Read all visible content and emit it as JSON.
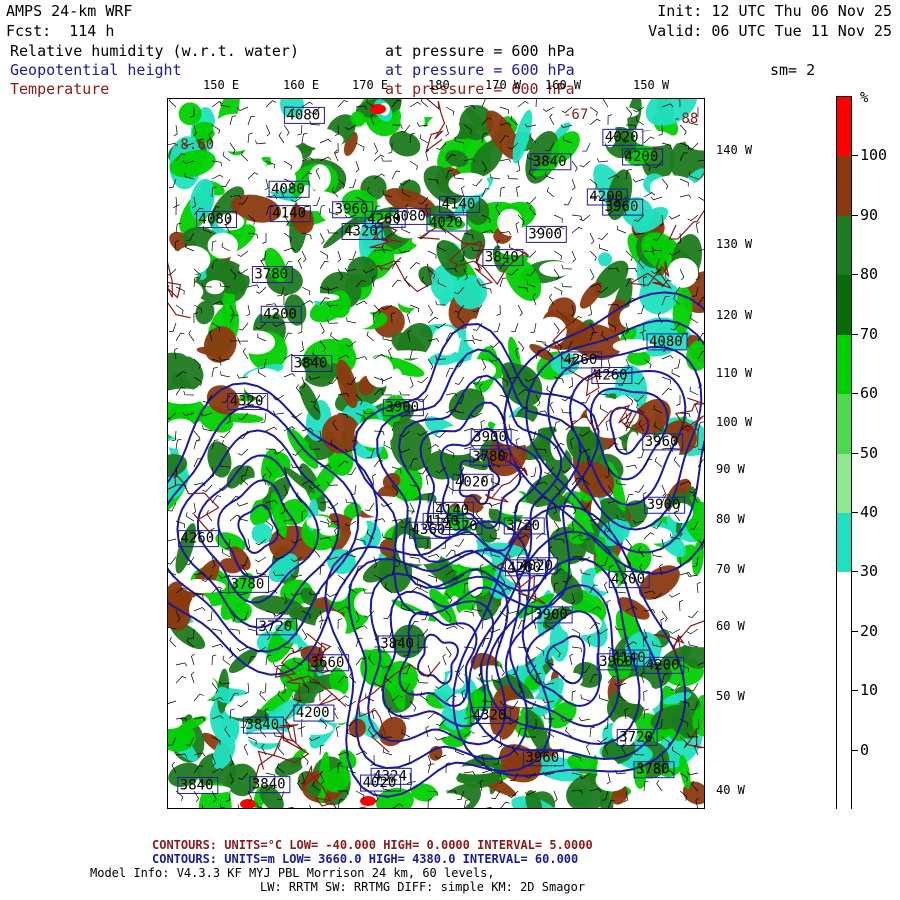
{
  "header": {
    "model": "AMPS 24-km WRF",
    "fcst_label": "Fcst:",
    "fcst_value": "114 h",
    "init": "Init: 12 UTC Thu 06 Nov 25",
    "valid": "Valid: 06 UTC Tue 11 Nov 25",
    "line1_field": "Relative humidity (w.r.t. water)",
    "line1_level": "at pressure =  600 hPa",
    "line2_field": "Geopotential height",
    "line2_level": "at pressure =  600 hPa",
    "line3_field": "Temperature",
    "line3_level": "at pressure =  600 hPa",
    "smoothing": "sm= 2"
  },
  "lon_labels": [
    "150 E",
    "160 E",
    "170 E",
    "180",
    "170 W",
    "160 W",
    "150 W"
  ],
  "lat_labels": [
    "140 W",
    "130 W",
    "120 W",
    "110 W",
    "100 W",
    "90 W",
    "80 W",
    "70 W",
    "60 W",
    "50 W",
    "40 W"
  ],
  "colorbar": {
    "unit": "%",
    "labels": [
      "100",
      "90",
      "80",
      "70",
      "60",
      "50",
      "40",
      "30",
      "20",
      "10",
      "0"
    ],
    "colors": [
      "#ff0000",
      "#8b3a0f",
      "#1e7a1e",
      "#0a6a0a",
      "#00d000",
      "#4ed84e",
      "#8fe88f",
      "#20e0c0",
      "#ffffff",
      "#ffffff",
      "#ffffff",
      "#ffffff"
    ]
  },
  "map": {
    "height_contour_labels": [
      "4260",
      "4200",
      "4140",
      "4020",
      "4140",
      "4200",
      "4200",
      "4324",
      "4360",
      "4320",
      "4320",
      "4080",
      "4020",
      "4200",
      "4140",
      "3960",
      "3900",
      "3840",
      "3780",
      "3840",
      "3900",
      "4020",
      "3960",
      "3840",
      "4080",
      "3720",
      "3780",
      "3900",
      "3960",
      "3840",
      "3900",
      "4020",
      "4080",
      "4140",
      "4200",
      "4260",
      "4320",
      "4080",
      "4020",
      "3960",
      "3840",
      "4200",
      "4260",
      "4320",
      "4260",
      "4200",
      "3960",
      "3900",
      "3840",
      "3780",
      "3720",
      "3660",
      "4140",
      "4080",
      "3840",
      "3780",
      "3720"
    ],
    "temperature_contour_labels": [
      "-8.60",
      "-88",
      "-67"
    ]
  },
  "footer": {
    "temp_line": "CONTOURS:  UNITS=°C  LOW= -40.000        HIGH=  0.0000        INTERVAL=   5.0000",
    "height_line": "CONTOURS:  UNITS=m  LOW=  3660.0        HIGH=  4380.0        INTERVAL=   60.000",
    "model_info": "Model Info: V4.3.3   KF      MYJ PBL  Morrison            24 km,   60 levels,",
    "model_info2": "LW: RRTM SW: RRTMG   DIFF: simple KM: 2D Smagor"
  },
  "colors": {
    "rh_green": "#1e7a1e",
    "rh_light": "#00d000",
    "rh_cyan": "#20e0c0",
    "rh_brown": "#8b3a0f",
    "height_contour": "#1a1aa0",
    "temp_contour": "#8b1a1a"
  }
}
